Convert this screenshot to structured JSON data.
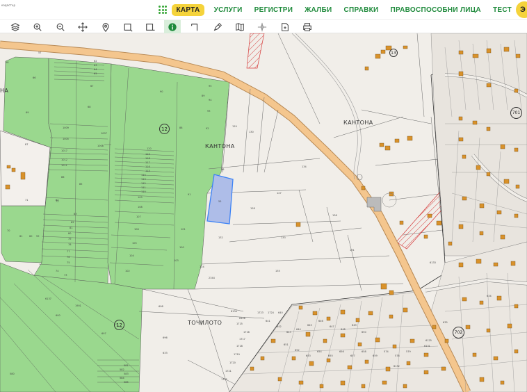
{
  "brand": {
    "text": "кадастър"
  },
  "nav": {
    "active": "КАРТА",
    "items": [
      "УСЛУГИ",
      "РЕГИСТРИ",
      "ЖАЛБИ",
      "СПРАВКИ",
      "ПРАВОСПОСОБНИ ЛИЦА",
      "ТЕСТ"
    ],
    "avatar_initial": "Э"
  },
  "toolbar": {
    "tools": [
      "layers-icon",
      "zoom-in-icon",
      "zoom-out-icon",
      "pan-icon",
      "location-pin-icon",
      "select-rect-icon",
      "select-rect-minus-icon",
      "info-icon",
      "measure-icon",
      "draw-icon",
      "map-icon",
      "compass-icon",
      "document-icon",
      "print-icon"
    ],
    "active_tool": "info-icon"
  },
  "map": {
    "area_labels": [
      "КАНТОНА",
      "КАНТОНА",
      "ТОЧИЛОТО",
      "НА"
    ],
    "badges": [
      "12",
      "12",
      "13",
      "701",
      "702"
    ],
    "parcel_numbers": [
      "57",
      "62",
      "63",
      "64",
      "65",
      "66",
      "67",
      "68",
      "69",
      "1009",
      "1005",
      "1007",
      "1008",
      "1017",
      "1012",
      "1011",
      "120",
      "119",
      "118",
      "117",
      "116",
      "115",
      "114",
      "113",
      "112",
      "111",
      "110",
      "109",
      "108",
      "107",
      "106",
      "105",
      "104",
      "103",
      "102",
      "101",
      "100",
      "95",
      "94",
      "93",
      "92",
      "91",
      "90",
      "89",
      "88",
      "87",
      "86",
      "85",
      "84",
      "83",
      "82",
      "81",
      "80",
      "79",
      "78",
      "77",
      "76",
      "75",
      "74",
      "73",
      "72",
      "71",
      "70",
      "61",
      "60",
      "59",
      "58",
      "56",
      "55",
      "132",
      "133",
      "134",
      "135",
      "136",
      "127",
      "128",
      "129",
      "130",
      "131",
      "724",
      "2344",
      "6137",
      "1901",
      "600",
      "697",
      "698",
      "696",
      "633",
      "634",
      "635",
      "6125",
      "6131",
      "6132",
      "6133",
      "6134",
      "6126",
      "1715",
      "1716",
      "1717",
      "1718",
      "1719",
      "1720",
      "1721",
      "1722",
      "1723",
      "1724",
      "640",
      "641",
      "642",
      "643",
      "644",
      "645",
      "646",
      "647",
      "648",
      "649",
      "650",
      "651",
      "652",
      "653",
      "654",
      "655",
      "656",
      "657",
      "658",
      "659",
      "574",
      "578",
      "579",
      "580",
      "581",
      "582",
      "583",
      "584",
      "585"
    ]
  },
  "colors": {
    "green_brand": "#1e8a3b",
    "accent_yellow": "#f5d33b",
    "agri_green": "#9ad88e",
    "road_orange": "#f4c68e",
    "selected_parcel": "#aebde8",
    "selected_outline": "#3b82f6",
    "building": "#d9922a",
    "hatch_red": "#d63a3a"
  }
}
